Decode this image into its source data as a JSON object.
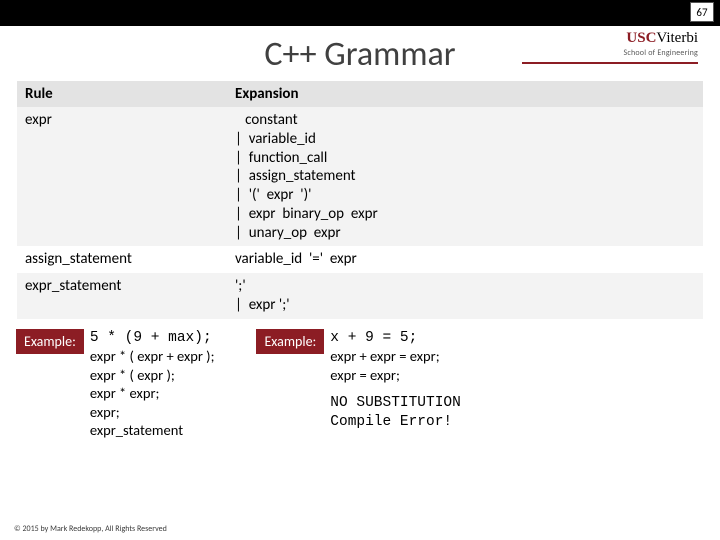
{
  "page_number": "67",
  "logo": {
    "usc": "USC",
    "viterbi": "Viterbi",
    "subtitle": "School of Engineering"
  },
  "title": "C++ Grammar",
  "table": {
    "headers": {
      "rule": "Rule",
      "expansion": "Expansion"
    },
    "rows": [
      {
        "rule": "expr",
        "expansion": "   constant\n|  variable_id\n|  function_call\n|  assign_statement\n|  '('  expr  ')'\n|  expr  binary_op  expr\n|  unary_op  expr"
      },
      {
        "rule": "assign_statement",
        "expansion": "variable_id  '='  expr"
      },
      {
        "rule": "expr_statement",
        "expansion": "';'\n|  expr ';'"
      }
    ]
  },
  "example_label": "Example:",
  "example1": {
    "code": "5 * (9 + max);",
    "deriv": [
      "expr * ( expr + expr );",
      "expr * ( expr );",
      "expr * expr;",
      "expr;",
      "expr_statement"
    ]
  },
  "example2": {
    "code": "x + 9 = 5;",
    "deriv": [
      "expr + expr = expr;",
      "expr = expr;"
    ],
    "error": "NO SUBSTITUTION\nCompile Error!"
  },
  "footer": "© 2015 by Mark Redekopp, All Rights Reserved"
}
